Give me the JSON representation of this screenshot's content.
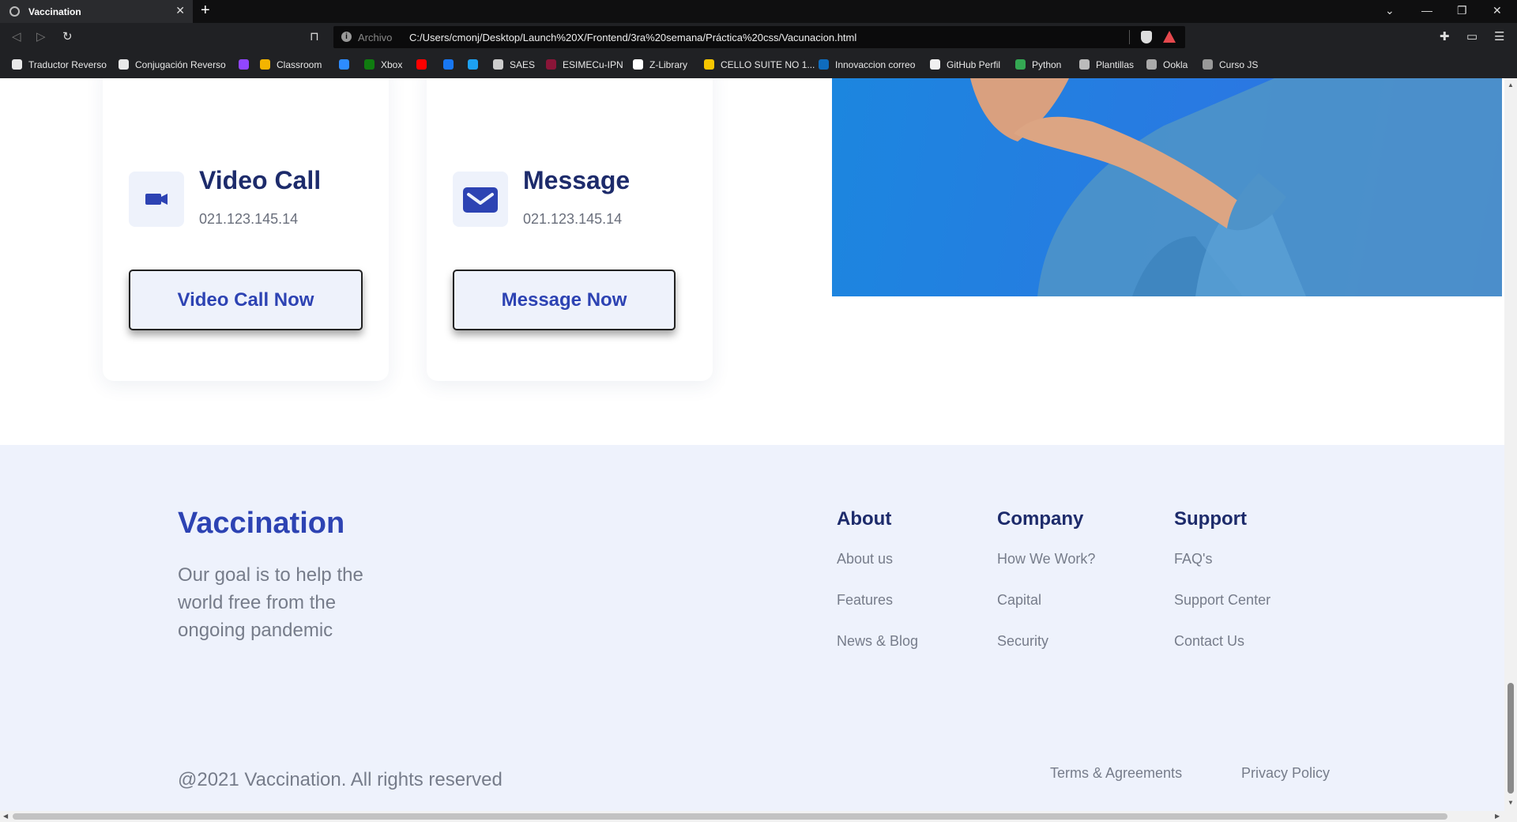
{
  "browser": {
    "tab_title": "Vaccination",
    "tab_close": "✕",
    "new_tab": "+",
    "url_scheme": "Archivo",
    "url": "C:/Users/cmonj/Desktop/Launch%20X/Frontend/3ra%20semana/Práctica%20css/Vacunacion.html",
    "bookmarks": [
      {
        "label": "Traductor Reverso",
        "color": "#e8e8e8"
      },
      {
        "label": "Conjugación Reverso",
        "color": "#e8e8e8"
      },
      {
        "label": "",
        "color": "#9146ff"
      },
      {
        "label": "Classroom",
        "color": "#f4b400"
      },
      {
        "label": "",
        "color": "#2d8cff"
      },
      {
        "label": "Xbox",
        "color": "#107c10"
      },
      {
        "label": "",
        "color": "#ff0000"
      },
      {
        "label": "",
        "color": "#1877f2"
      },
      {
        "label": "",
        "color": "#1da1f2"
      },
      {
        "label": "SAES",
        "color": "#cccccc"
      },
      {
        "label": "ESIMECu-IPN",
        "color": "#8a1538"
      },
      {
        "label": "Z-Library",
        "color": "#ffffff"
      },
      {
        "label": "CELLO SUITE NO 1...",
        "color": "#f7c600"
      },
      {
        "label": "Innovaccion correo",
        "color": "#0f6cbd"
      },
      {
        "label": "GitHub Perfil",
        "color": "#f0f0f0"
      },
      {
        "label": "Python",
        "color": "#34a853"
      },
      {
        "label": "Plantillas",
        "color": "#bbbbbb"
      },
      {
        "label": "Ookla",
        "color": "#aaaaaa"
      },
      {
        "label": "Curso JS",
        "color": "#999999"
      }
    ]
  },
  "contact_cards": [
    {
      "title": "Video Call",
      "phone": "021.123.145.14",
      "button": "Video Call Now",
      "icon": "video-camera-icon"
    },
    {
      "title": "Message",
      "phone": "021.123.145.14",
      "button": "Message Now",
      "icon": "envelope-icon"
    }
  ],
  "footer": {
    "brand": "Vaccination",
    "tagline": "Our goal is to help the world free from the ongoing pandemic",
    "columns": [
      {
        "heading": "About",
        "links": [
          "About us",
          "Features",
          "News & Blog"
        ]
      },
      {
        "heading": "Company",
        "links": [
          "How We Work?",
          "Capital",
          "Security"
        ]
      },
      {
        "heading": "Support",
        "links": [
          "FAQ's",
          "Support Center",
          "Contact Us"
        ]
      }
    ],
    "copyright": "@2021 Vaccination. All rights reserved",
    "terms": "Terms & Agreements",
    "privacy": "Privacy Policy"
  },
  "colors": {
    "brand_blue": "#2d43b3",
    "heading_navy": "#1d2b6b",
    "muted_text": "#767c8a",
    "footer_bg": "#eef2fc",
    "hero_blue": "#1c86df"
  }
}
